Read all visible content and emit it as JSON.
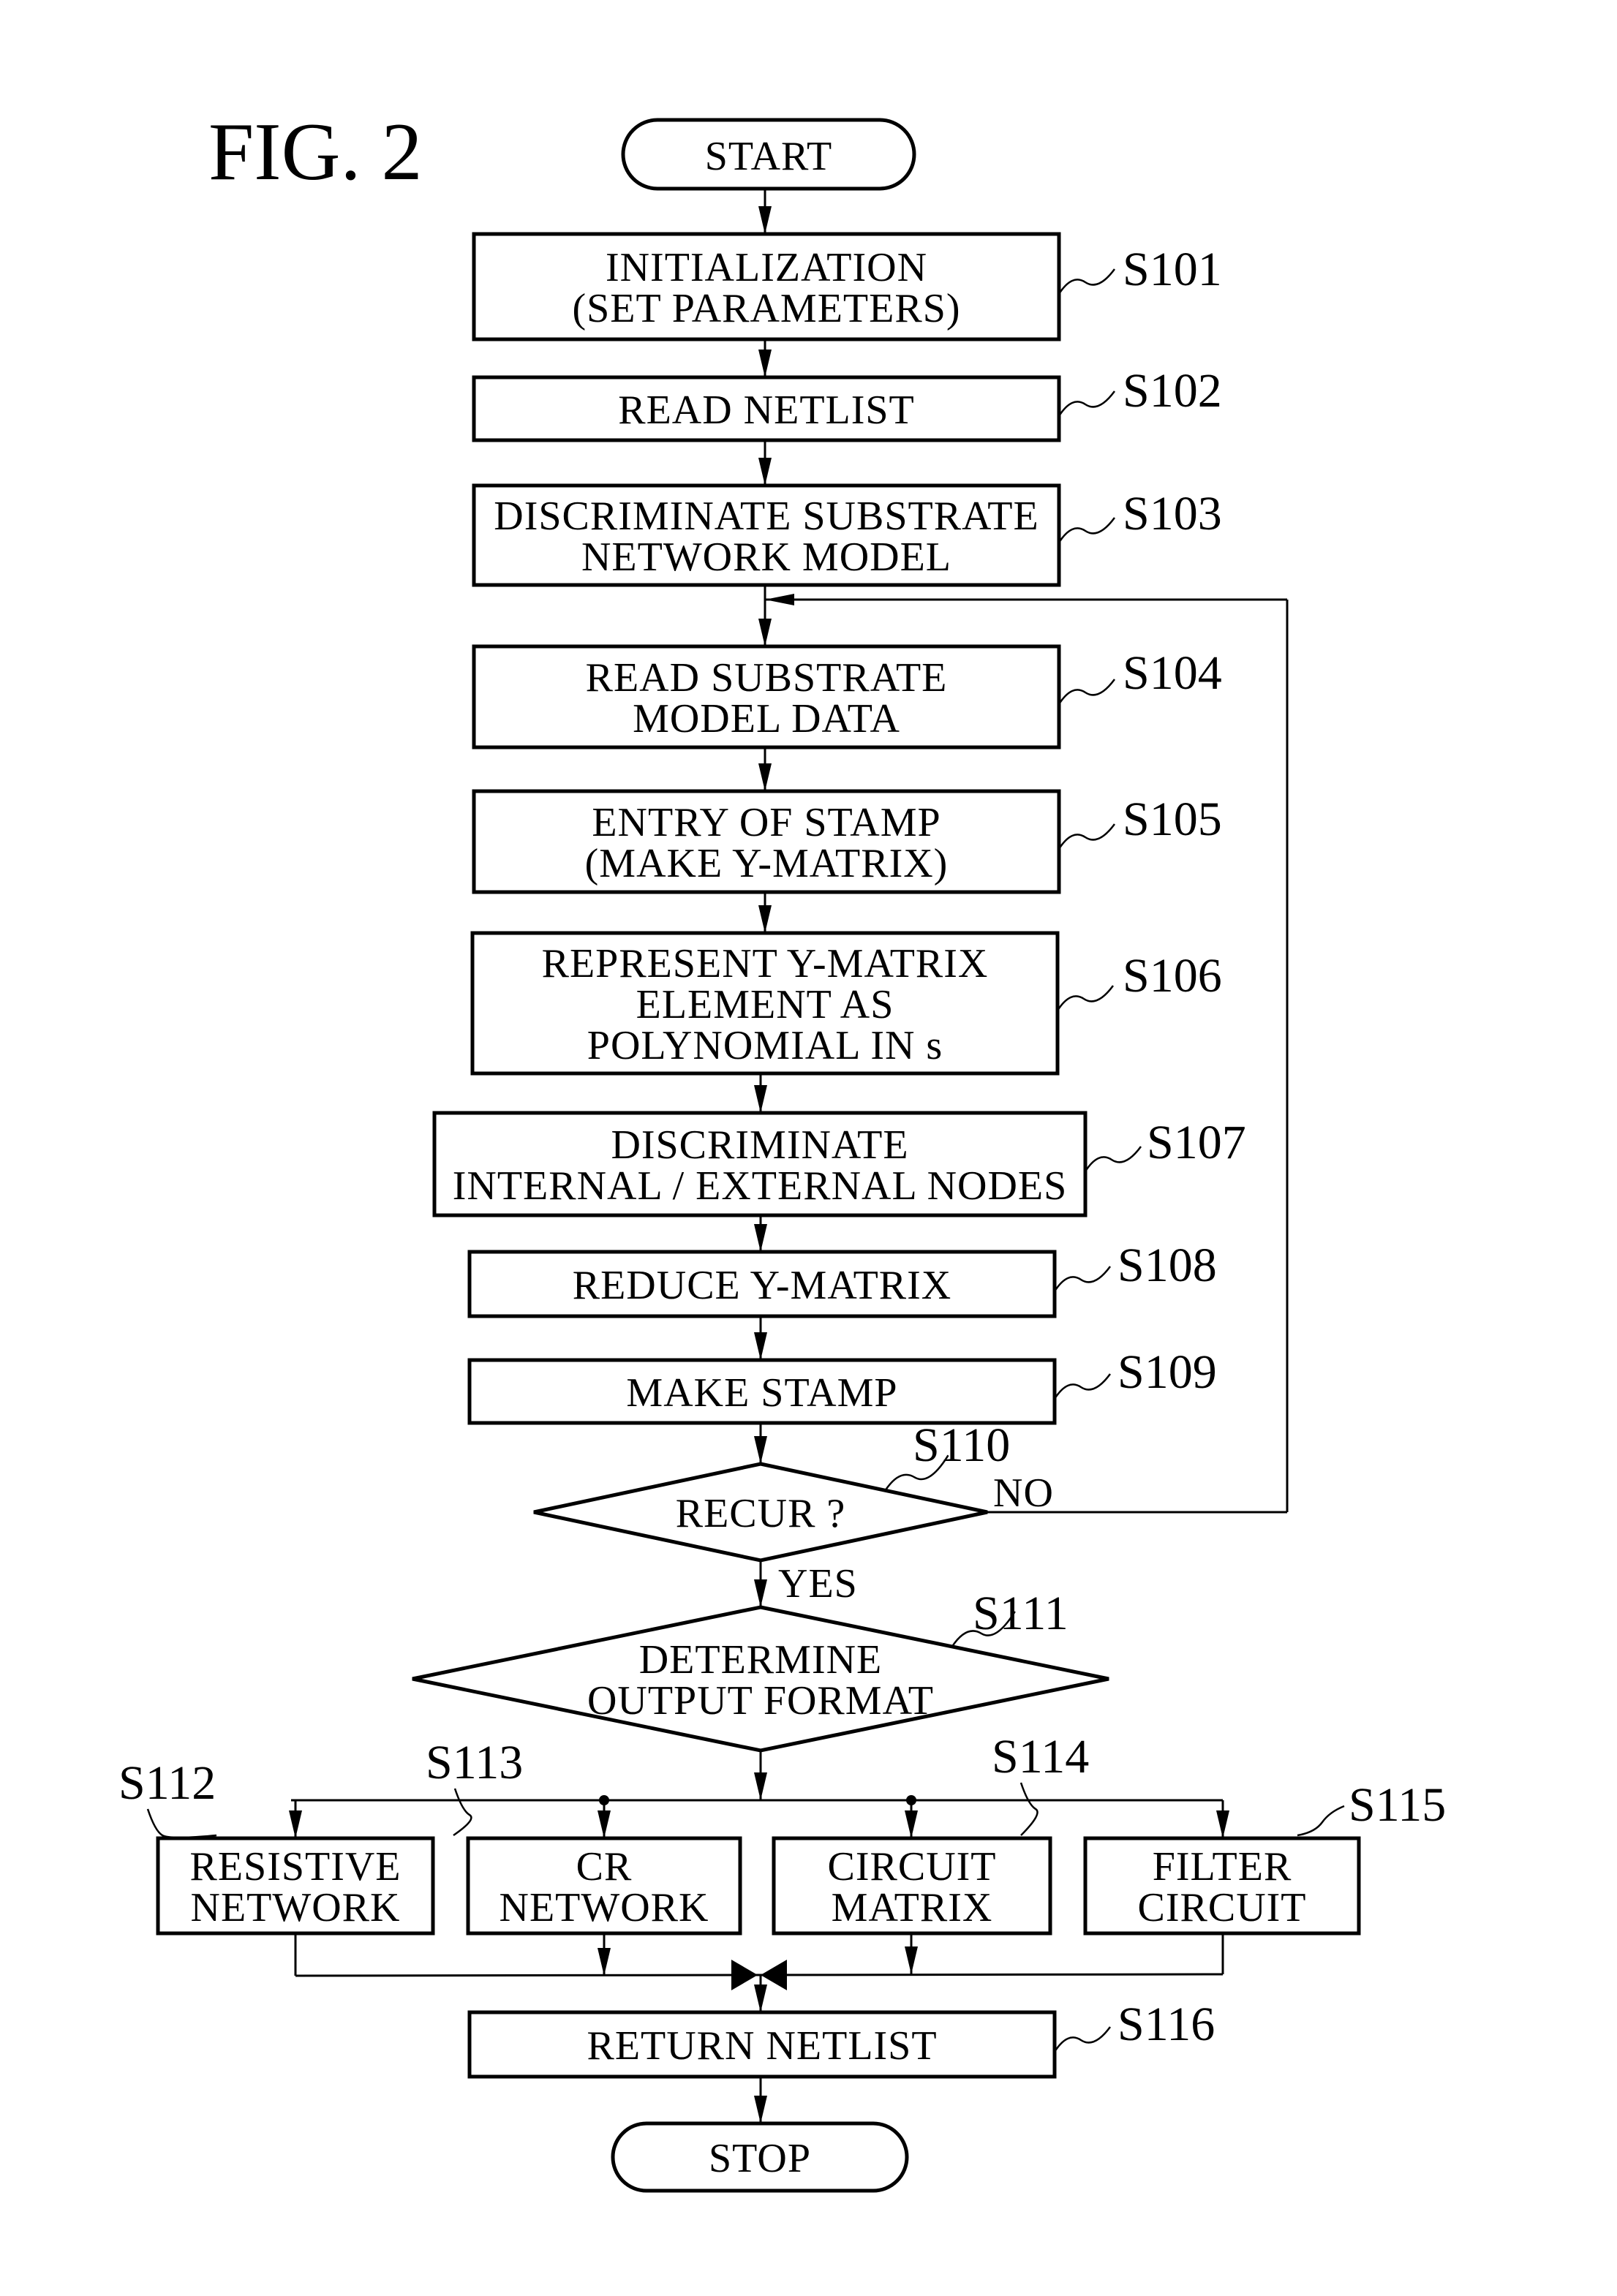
{
  "figure": {
    "title": "FIG. 2"
  },
  "terminals": {
    "start": "START",
    "stop": "STOP"
  },
  "steps": [
    {
      "id": "S101",
      "lines": [
        "INITIALIZATION",
        "(SET PARAMETERS)"
      ]
    },
    {
      "id": "S102",
      "lines": [
        "READ NETLIST"
      ]
    },
    {
      "id": "S103",
      "lines": [
        "DISCRIMINATE SUBSTRATE",
        "NETWORK MODEL"
      ]
    },
    {
      "id": "S104",
      "lines": [
        "READ SUBSTRATE",
        "MODEL DATA"
      ]
    },
    {
      "id": "S105",
      "lines": [
        "ENTRY OF STAMP",
        "(MAKE Y-MATRIX)"
      ]
    },
    {
      "id": "S106",
      "lines": [
        "REPRESENT Y-MATRIX",
        "ELEMENT AS",
        "POLYNOMIAL IN s"
      ]
    },
    {
      "id": "S107",
      "lines": [
        "DISCRIMINATE",
        "INTERNAL / EXTERNAL NODES"
      ]
    },
    {
      "id": "S108",
      "lines": [
        "REDUCE Y-MATRIX"
      ]
    },
    {
      "id": "S109",
      "lines": [
        "MAKE STAMP"
      ]
    },
    {
      "id": "S110",
      "lines": [
        "RECUR ?"
      ]
    },
    {
      "id": "S111",
      "lines": [
        "DETERMINE",
        "OUTPUT FORMAT"
      ]
    },
    {
      "id": "S112",
      "lines": [
        "RESISTIVE",
        "NETWORK"
      ]
    },
    {
      "id": "S113",
      "lines": [
        "CR",
        "NETWORK"
      ]
    },
    {
      "id": "S114",
      "lines": [
        "CIRCUIT",
        "MATRIX"
      ]
    },
    {
      "id": "S115",
      "lines": [
        "FILTER",
        "CIRCUIT"
      ]
    },
    {
      "id": "S116",
      "lines": [
        "RETURN NETLIST"
      ]
    }
  ],
  "branches": {
    "recur_no": "NO",
    "recur_yes": "YES"
  }
}
